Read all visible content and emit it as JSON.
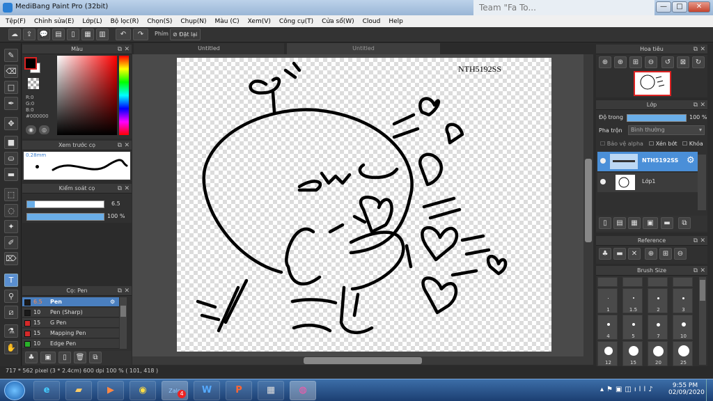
{
  "window": {
    "title": "MediBang Paint Pro (32bit)",
    "minimize": "—",
    "maximize": "□",
    "close": "✕"
  },
  "background_page": {
    "title": "Team \"Fa To..."
  },
  "menu": [
    "Tệp(F)",
    "Chỉnh sửa(E)",
    "Lớp(L)",
    "Bộ lọc(R)",
    "Chọn(S)",
    "Chụp(N)",
    "Màu (C)",
    "Xem(V)",
    "Công cụ(T)",
    "Cửa sổ(W)",
    "Cloud",
    "Help"
  ],
  "toolbar": {
    "phim_label": "Phím",
    "reset_label": "Đặt lại"
  },
  "tabs": [
    "Untitled",
    "Untitled"
  ],
  "color_panel": {
    "title": "Màu",
    "r": "R:0",
    "g": "G:0",
    "b": "B:0",
    "hex": "#000000",
    "primary_color": "#000000"
  },
  "preview_panel": {
    "title": "Xem trước cọ",
    "size": "0.28mm"
  },
  "brush_control": {
    "title": "Kiểm soát cọ",
    "size_value": "6.5",
    "opacity_value": "100 %",
    "size_fraction": 0.1,
    "opacity_fraction": 1.0
  },
  "brush_panel": {
    "title": "Cọ: Pen",
    "items": [
      {
        "size": "6.5",
        "name": "Pen",
        "color": "#1a1a1a",
        "selected": true
      },
      {
        "size": "10",
        "name": "Pen (Sharp)",
        "color": "#1a1a1a"
      },
      {
        "size": "15",
        "name": "G Pen",
        "color": "#d42a2a"
      },
      {
        "size": "15",
        "name": "Mapping Pen",
        "color": "#d42a2a"
      },
      {
        "size": "10",
        "name": "Edge Pen",
        "color": "#2ab12a"
      }
    ]
  },
  "canvas": {
    "watermark": "NTH5192SS"
  },
  "navigator": {
    "title": "Hoa tiêu"
  },
  "layer_panel": {
    "title": "Lớp",
    "opacity_label": "Độ trong",
    "opacity_value": "100 %",
    "opacity_fraction": 1.0,
    "blend_label": "Pha trộn",
    "blend_value": "Bình thường",
    "protect_alpha": "Bảo vệ alpha",
    "clipping": "Xén bớt",
    "lock": "Khóa",
    "layers": [
      {
        "name": "NTH5192SS",
        "selected": true
      },
      {
        "name": "Lớp1"
      }
    ]
  },
  "reference_panel": {
    "title": "Reference"
  },
  "brush_size_panel": {
    "title": "Brush Size",
    "sizes": [
      "1",
      "1.5",
      "2",
      "3",
      "4",
      "5",
      "7",
      "10",
      "12",
      "15",
      "20",
      "25"
    ]
  },
  "status": {
    "text": "717 * 562 pixel  (3 * 2.4cm)  600 dpi  100 %  ( 101, 418 )"
  },
  "taskbar": {
    "time": "9:55 PM",
    "date": "02/09/2020",
    "zalo_badge": "4",
    "zalo_label": "Zalo"
  }
}
